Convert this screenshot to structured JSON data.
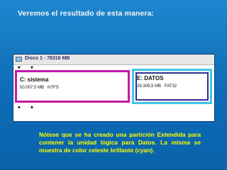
{
  "slide": {
    "title": "Veremos el resultado de esta manera:",
    "note": "Nótese que se ha creado una partición Extendida para contener la unidad lógica para Datos. La misma se muestra de color celeste brillante (cyan)."
  },
  "disk": {
    "title": "Disco 1 - 76316 MB",
    "icon": "disk-icon",
    "partitions": [
      {
        "name": "C:  sistema",
        "size": "50.007,0 MB",
        "filesystem": "NTFS",
        "border_color": "#c11aa6"
      },
      {
        "name": "E:  DATOS",
        "size": "26.309,5 MB",
        "filesystem": "FAT32",
        "border_color": "#3ec7ea",
        "inner_border_color": "#2f2f90"
      }
    ]
  },
  "markers": {
    "down": "▼",
    "up": "▲"
  },
  "colors": {
    "background": "#0c6cb5",
    "title_text": "#f5f5f5",
    "note_text": "#ffff00"
  }
}
